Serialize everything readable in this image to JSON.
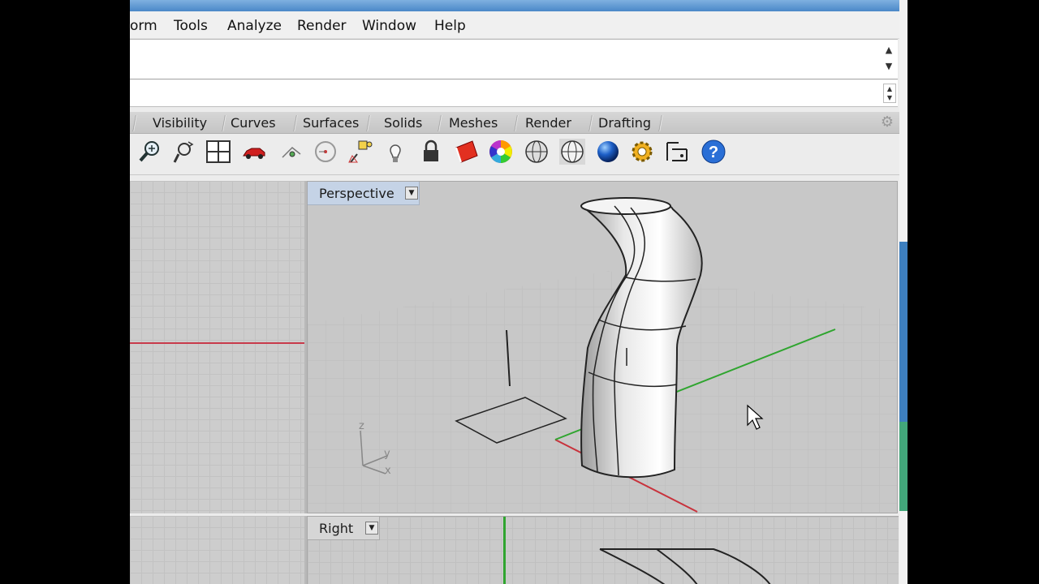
{
  "menu": [
    "orm",
    "Tools",
    "Analyze",
    "Render",
    "Window",
    "Help"
  ],
  "tabs": [
    "Visibility",
    "Curves",
    "Surfaces",
    "Solids",
    "Meshes",
    "Render",
    "Drafting"
  ],
  "toolbar_icons": [
    "zoom-icon",
    "rotate-view-icon",
    "grid-view-icon",
    "car-icon",
    "snap-icon",
    "circle-icon",
    "point-icon",
    "lightbulb-icon",
    "lock-icon",
    "shaded-icon",
    "color-wheel-icon",
    "sphere-wireframe-icon",
    "sphere-ghosted-icon",
    "sphere-render-icon",
    "gear-settings-icon",
    "dimension-icon",
    "help-icon"
  ],
  "viewports": {
    "perspective": {
      "label": "Perspective"
    },
    "right": {
      "label": "Right"
    }
  },
  "axis_labels": {
    "z": "z",
    "y": "y",
    "x": "x"
  },
  "colors": {
    "x_axis": "#c8323c",
    "y_axis": "#2fa52f",
    "active_label_bg": "#c5d3e6"
  }
}
